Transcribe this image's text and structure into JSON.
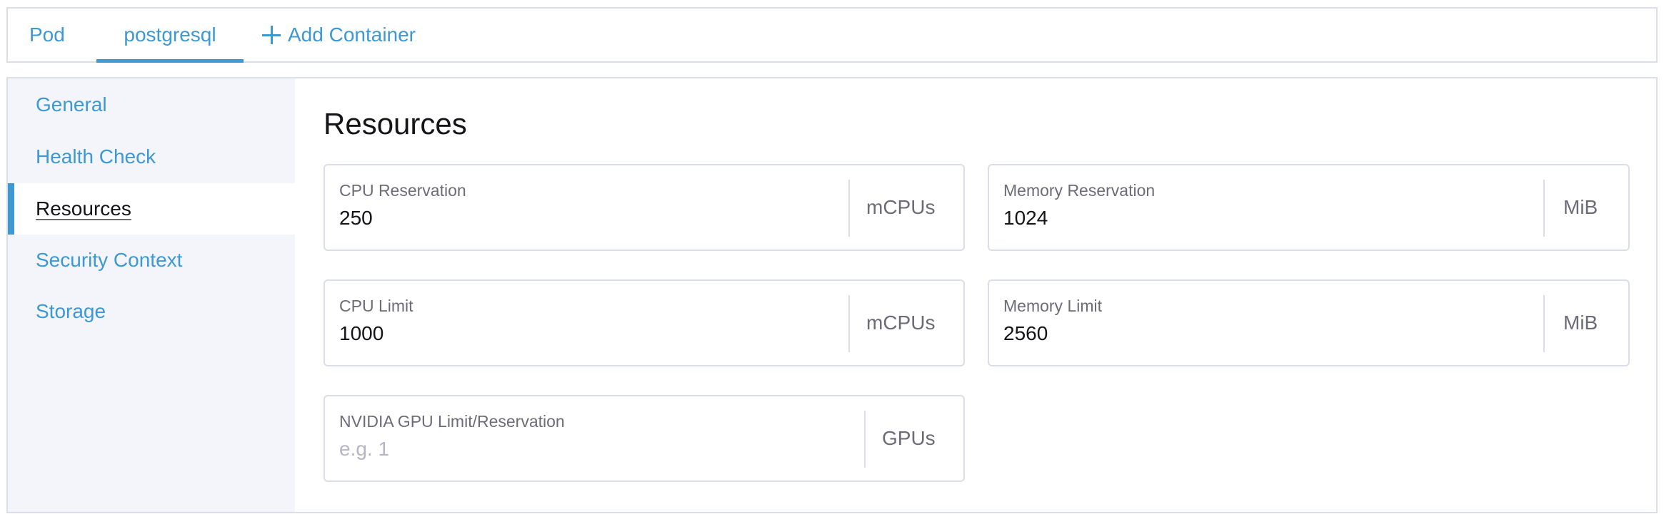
{
  "tabs": [
    {
      "label": "Pod"
    },
    {
      "label": "postgresql"
    },
    {
      "label": "Add Container"
    }
  ],
  "sidebar": {
    "items": [
      {
        "label": "General"
      },
      {
        "label": "Health Check"
      },
      {
        "label": "Resources"
      },
      {
        "label": "Security Context"
      },
      {
        "label": "Storage"
      }
    ]
  },
  "section": {
    "title": "Resources"
  },
  "fields": {
    "cpu_reservation": {
      "label": "CPU Reservation",
      "value": "250",
      "unit": "mCPUs"
    },
    "memory_reservation": {
      "label": "Memory Reservation",
      "value": "1024",
      "unit": "MiB"
    },
    "cpu_limit": {
      "label": "CPU Limit",
      "value": "1000",
      "unit": "mCPUs"
    },
    "memory_limit": {
      "label": "Memory Limit",
      "value": "2560",
      "unit": "MiB"
    },
    "gpu_limit": {
      "label": "NVIDIA GPU Limit/Reservation",
      "value": "",
      "placeholder": "e.g. 1",
      "unit": "GPUs"
    }
  },
  "colors": {
    "accent": "#3d98d3",
    "border": "#dcdee7",
    "sidebar_bg": "#f4f5fa"
  }
}
